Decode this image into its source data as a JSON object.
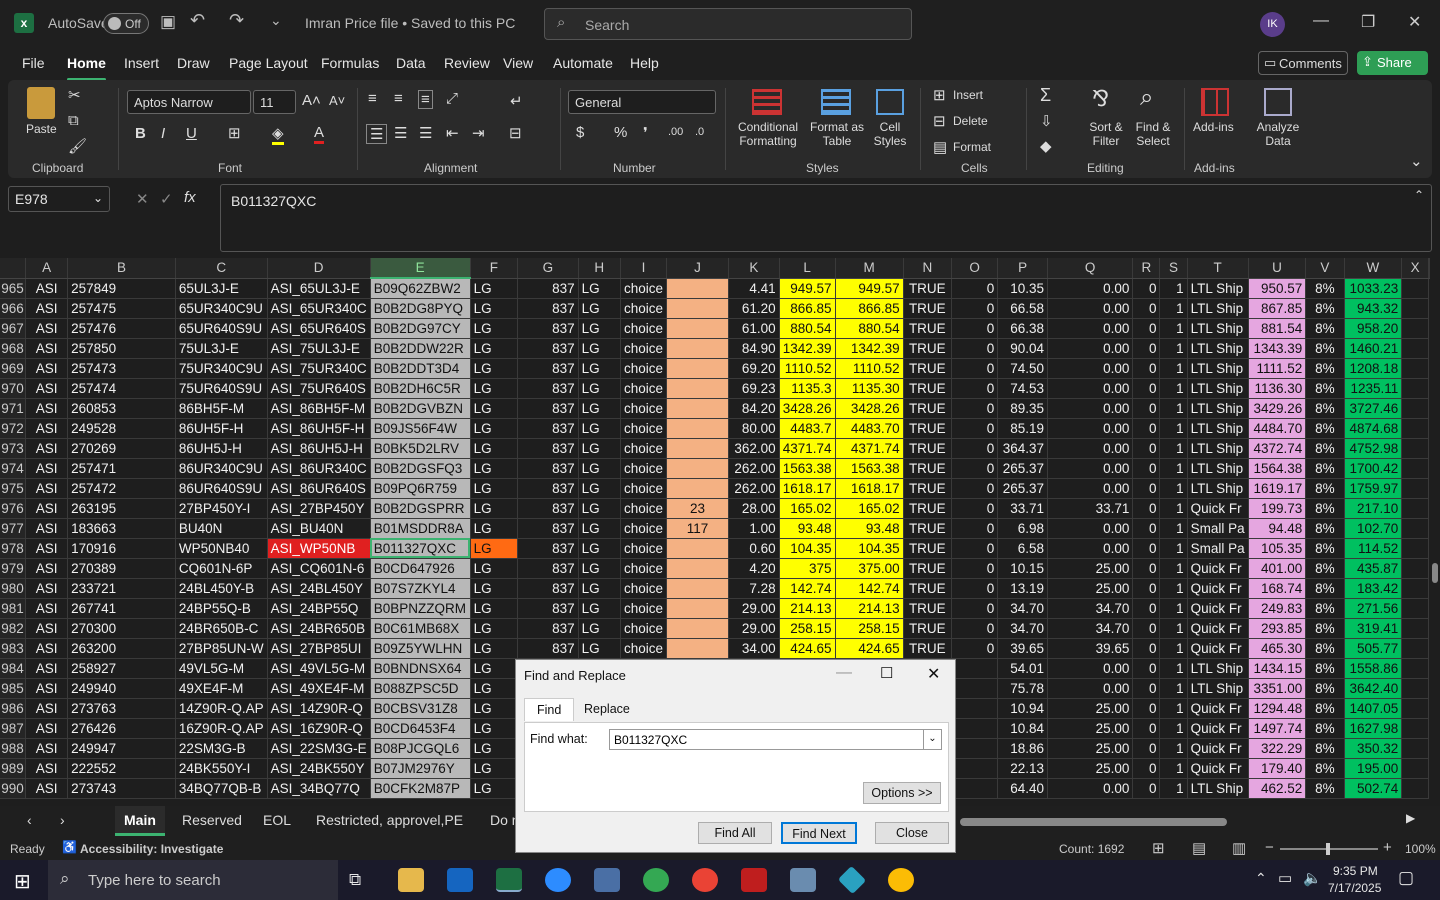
{
  "titlebar": {
    "autosave_label": "AutoSave",
    "autosave_state": "Off",
    "file_title": "Imran Price file • Saved to this PC",
    "search_placeholder": "Search",
    "avatar": "IK"
  },
  "menu": [
    "File",
    "Home",
    "Insert",
    "Draw",
    "Page Layout",
    "Formulas",
    "Data",
    "Review",
    "View",
    "Automate",
    "Help"
  ],
  "active_menu": "Home",
  "actions": {
    "comments": "Comments",
    "share": "Share"
  },
  "ribbon": {
    "clipboard": {
      "label": "Clipboard",
      "paste": "Paste"
    },
    "font": {
      "label": "Font",
      "name": "Aptos Narrow",
      "size": "11"
    },
    "alignment": {
      "label": "Alignment"
    },
    "number": {
      "label": "Number",
      "format": "General"
    },
    "styles": {
      "label": "Styles",
      "conditional": "Conditional Formatting",
      "format_table": "Format as Table",
      "cell_styles": "Cell Styles"
    },
    "cells": {
      "label": "Cells",
      "insert": "Insert",
      "delete": "Delete",
      "format": "Format"
    },
    "editing": {
      "label": "Editing",
      "sort": "Sort & Filter",
      "find": "Find & Select"
    },
    "addins": {
      "label": "Add-ins",
      "addins": "Add-ins",
      "analyze": "Analyze Data"
    }
  },
  "formula": {
    "name_box": "E978",
    "fx": "fx",
    "value": "B011327QXC"
  },
  "grid": {
    "columns": [
      "A",
      "B",
      "C",
      "D",
      "E",
      "F",
      "G",
      "H",
      "I",
      "J",
      "K",
      "L",
      "M",
      "N",
      "O",
      "P",
      "Q",
      "R",
      "S",
      "T",
      "U",
      "V",
      "W",
      "X"
    ],
    "rows": [
      [
        "965",
        "ASI",
        "257849",
        "65UL3J-E",
        "ASI_65UL3J-E",
        "B09Q62ZBW2",
        "LG",
        "837",
        "LG",
        "choice",
        "",
        "4.41",
        "949.57",
        "949.57",
        "TRUE",
        "0",
        "10.35",
        "0.00",
        "0",
        "1",
        "LTL Ship",
        "950.57",
        "8%",
        "1033.23"
      ],
      [
        "966",
        "ASI",
        "257475",
        "65UR340C9U",
        "ASI_65UR340C",
        "B0B2DG8PYQ",
        "LG",
        "837",
        "LG",
        "choice",
        "",
        "61.20",
        "866.85",
        "866.85",
        "TRUE",
        "0",
        "66.58",
        "0.00",
        "0",
        "1",
        "LTL Ship",
        "867.85",
        "8%",
        "943.32"
      ],
      [
        "967",
        "ASI",
        "257476",
        "65UR640S9U",
        "ASI_65UR640S",
        "B0B2DG97CY",
        "LG",
        "837",
        "LG",
        "choice",
        "",
        "61.00",
        "880.54",
        "880.54",
        "TRUE",
        "0",
        "66.38",
        "0.00",
        "0",
        "1",
        "LTL Ship",
        "881.54",
        "8%",
        "958.20"
      ],
      [
        "968",
        "ASI",
        "257850",
        "75UL3J-E",
        "ASI_75UL3J-E",
        "B0B2DDW22R",
        "LG",
        "837",
        "LG",
        "choice",
        "",
        "84.90",
        "1342.39",
        "1342.39",
        "TRUE",
        "0",
        "90.04",
        "0.00",
        "0",
        "1",
        "LTL Ship",
        "1343.39",
        "8%",
        "1460.21"
      ],
      [
        "969",
        "ASI",
        "257473",
        "75UR340C9U",
        "ASI_75UR340C",
        "B0B2DDT3D4",
        "LG",
        "837",
        "LG",
        "choice",
        "",
        "69.20",
        "1110.52",
        "1110.52",
        "TRUE",
        "0",
        "74.50",
        "0.00",
        "0",
        "1",
        "LTL Ship",
        "1111.52",
        "8%",
        "1208.18"
      ],
      [
        "970",
        "ASI",
        "257474",
        "75UR640S9U",
        "ASI_75UR640S",
        "B0B2DH6C5R",
        "LG",
        "837",
        "LG",
        "choice",
        "",
        "69.23",
        "1135.3",
        "1135.30",
        "TRUE",
        "0",
        "74.53",
        "0.00",
        "0",
        "1",
        "LTL Ship",
        "1136.30",
        "8%",
        "1235.11"
      ],
      [
        "971",
        "ASI",
        "260853",
        "86BH5F-M",
        "ASI_86BH5F-M",
        "B0B2DGVBZN",
        "LG",
        "837",
        "LG",
        "choice",
        "",
        "84.20",
        "3428.26",
        "3428.26",
        "TRUE",
        "0",
        "89.35",
        "0.00",
        "0",
        "1",
        "LTL Ship",
        "3429.26",
        "8%",
        "3727.46"
      ],
      [
        "972",
        "ASI",
        "249528",
        "86UH5F-H",
        "ASI_86UH5F-H",
        "B09JS56F4W",
        "LG",
        "837",
        "LG",
        "choice",
        "",
        "80.00",
        "4483.7",
        "4483.70",
        "TRUE",
        "0",
        "85.19",
        "0.00",
        "0",
        "1",
        "LTL Ship",
        "4484.70",
        "8%",
        "4874.68"
      ],
      [
        "973",
        "ASI",
        "270269",
        "86UH5J-H",
        "ASI_86UH5J-H",
        "B0BK5D2LRV",
        "LG",
        "837",
        "LG",
        "choice",
        "",
        "362.00",
        "4371.74",
        "4371.74",
        "TRUE",
        "0",
        "364.37",
        "0.00",
        "0",
        "1",
        "LTL Ship",
        "4372.74",
        "8%",
        "4752.98"
      ],
      [
        "974",
        "ASI",
        "257471",
        "86UR340C9U",
        "ASI_86UR340C",
        "B0B2DGSFQ3",
        "LG",
        "837",
        "LG",
        "choice",
        "",
        "262.00",
        "1563.38",
        "1563.38",
        "TRUE",
        "0",
        "265.37",
        "0.00",
        "0",
        "1",
        "LTL Ship",
        "1564.38",
        "8%",
        "1700.42"
      ],
      [
        "975",
        "ASI",
        "257472",
        "86UR640S9U",
        "ASI_86UR640S",
        "B09PQ6R759",
        "LG",
        "837",
        "LG",
        "choice",
        "",
        "262.00",
        "1618.17",
        "1618.17",
        "TRUE",
        "0",
        "265.37",
        "0.00",
        "0",
        "1",
        "LTL Ship",
        "1619.17",
        "8%",
        "1759.97"
      ],
      [
        "976",
        "ASI",
        "263195",
        "27BP450Y-I",
        "ASI_27BP450Y",
        "B0B2DGSPRR",
        "LG",
        "837",
        "LG",
        "choice",
        "23",
        "28.00",
        "165.02",
        "165.02",
        "TRUE",
        "0",
        "33.71",
        "33.71",
        "0",
        "1",
        "Quick Fr",
        "199.73",
        "8%",
        "217.10"
      ],
      [
        "977",
        "ASI",
        "183663",
        "BU40N",
        "ASI_BU40N",
        "B01MSDDR8A",
        "LG",
        "837",
        "LG",
        "choice",
        "117",
        "1.00",
        "93.48",
        "93.48",
        "TRUE",
        "0",
        "6.98",
        "0.00",
        "0",
        "1",
        "Small Pa",
        "94.48",
        "8%",
        "102.70"
      ],
      [
        "978",
        "ASI",
        "170916",
        "WP50NB40",
        "ASI_WP50NB",
        "B011327QXC",
        "LG",
        "837",
        "LG",
        "choice",
        "",
        "0.60",
        "104.35",
        "104.35",
        "TRUE",
        "0",
        "6.58",
        "0.00",
        "0",
        "1",
        "Small Pa",
        "105.35",
        "8%",
        "114.52"
      ],
      [
        "979",
        "ASI",
        "270389",
        "CQ601N-6P",
        "ASI_CQ601N-6",
        "B0CD647926",
        "LG",
        "837",
        "LG",
        "choice",
        "",
        "4.20",
        "375",
        "375.00",
        "TRUE",
        "0",
        "10.15",
        "25.00",
        "0",
        "1",
        "Quick Fr",
        "401.00",
        "8%",
        "435.87"
      ],
      [
        "980",
        "ASI",
        "233721",
        "24BL450Y-B",
        "ASI_24BL450Y",
        "B07S7ZKYL4",
        "LG",
        "837",
        "LG",
        "choice",
        "",
        "7.28",
        "142.74",
        "142.74",
        "TRUE",
        "0",
        "13.19",
        "25.00",
        "0",
        "1",
        "Quick Fr",
        "168.74",
        "8%",
        "183.42"
      ],
      [
        "981",
        "ASI",
        "267741",
        "24BP55Q-B",
        "ASI_24BP55Q",
        "B0BPNZZQRM",
        "LG",
        "837",
        "LG",
        "choice",
        "",
        "29.00",
        "214.13",
        "214.13",
        "TRUE",
        "0",
        "34.70",
        "34.70",
        "0",
        "1",
        "Quick Fr",
        "249.83",
        "8%",
        "271.56"
      ],
      [
        "982",
        "ASI",
        "270300",
        "24BR650B-C",
        "ASI_24BR650B",
        "B0C61MB68X",
        "LG",
        "837",
        "LG",
        "choice",
        "",
        "29.00",
        "258.15",
        "258.15",
        "TRUE",
        "0",
        "34.70",
        "34.70",
        "0",
        "1",
        "Quick Fr",
        "293.85",
        "8%",
        "319.41"
      ],
      [
        "983",
        "ASI",
        "263200",
        "27BP85UN-W",
        "ASI_27BP85UI",
        "B09Z5YWLHN",
        "LG",
        "837",
        "LG",
        "choice",
        "",
        "34.00",
        "424.65",
        "424.65",
        "TRUE",
        "0",
        "39.65",
        "39.65",
        "0",
        "1",
        "Quick Fr",
        "465.30",
        "8%",
        "505.77"
      ],
      [
        "984",
        "ASI",
        "258927",
        "49VL5G-M",
        "ASI_49VL5G-M",
        "B0BNDNSX64",
        "LG",
        "",
        "",
        "",
        "",
        "",
        "",
        "",
        "",
        "",
        "54.01",
        "0.00",
        "0",
        "1",
        "LTL Ship",
        "1434.15",
        "8%",
        "1558.86"
      ],
      [
        "985",
        "ASI",
        "249940",
        "49XE4F-M",
        "ASI_49XE4F-M",
        "B088ZPSC5D",
        "LG",
        "",
        "",
        "",
        "",
        "",
        "",
        "",
        "",
        "",
        "75.78",
        "0.00",
        "0",
        "1",
        "LTL Ship",
        "3351.00",
        "8%",
        "3642.40"
      ],
      [
        "986",
        "ASI",
        "273763",
        "14Z90R-Q.AP",
        "ASI_14Z90R-Q",
        "B0CBSV31Z8",
        "LG",
        "",
        "",
        "",
        "",
        "",
        "",
        "",
        "",
        "",
        "10.94",
        "25.00",
        "0",
        "1",
        "Quick Fr",
        "1294.48",
        "8%",
        "1407.05"
      ],
      [
        "987",
        "ASI",
        "276426",
        "16Z90R-Q.AP",
        "ASI_16Z90R-Q",
        "B0CD6453F4",
        "LG",
        "",
        "",
        "",
        "",
        "",
        "",
        "",
        "",
        "",
        "10.84",
        "25.00",
        "0",
        "1",
        "Quick Fr",
        "1497.74",
        "8%",
        "1627.98"
      ],
      [
        "988",
        "ASI",
        "249947",
        "22SM3G-B",
        "ASI_22SM3G-E",
        "B08PJCGQL6",
        "LG",
        "",
        "",
        "",
        "",
        "",
        "",
        "",
        "",
        "",
        "18.86",
        "25.00",
        "0",
        "1",
        "Quick Fr",
        "322.29",
        "8%",
        "350.32"
      ],
      [
        "989",
        "ASI",
        "222552",
        "24BK550Y-I",
        "ASI_24BK550Y",
        "B07JM2976Y",
        "LG",
        "",
        "",
        "",
        "",
        "",
        "",
        "",
        "",
        "",
        "22.13",
        "25.00",
        "0",
        "1",
        "Quick Fr",
        "179.40",
        "8%",
        "195.00"
      ],
      [
        "990",
        "ASI",
        "273743",
        "34BQ77QB-B",
        "ASI_34BQ77Q",
        "B0CFK2M87P",
        "LG",
        "",
        "",
        "",
        "",
        "",
        "",
        "",
        "",
        "",
        "64.40",
        "0.00",
        "0",
        "1",
        "LTL Ship",
        "462.52",
        "8%",
        "502.74"
      ]
    ]
  },
  "sheets": [
    "Main",
    "Reserved",
    "EOL",
    "Restricted, approvel,PE",
    "Do n"
  ],
  "active_sheet": "Main",
  "status": {
    "ready": "Ready",
    "accessibility": "Accessibility: Investigate",
    "count": "Count: 1692",
    "zoom": "100%"
  },
  "taskbar": {
    "search_placeholder": "Type here to search",
    "time": "9:35 PM",
    "date": "7/17/2025"
  },
  "dialog": {
    "title": "Find and Replace",
    "tab_find": "Find",
    "tab_replace": "Replace",
    "find_label": "Find what:",
    "find_value": "B011327QXC",
    "options": "Options >>",
    "find_all": "Find All",
    "find_next": "Find Next",
    "close": "Close"
  },
  "colors": {
    "accent_green": "#3cb371",
    "highlight_yellow": "#ffff00",
    "peach": "#f4b183",
    "pink": "#e5a6e0",
    "green_col": "#00c060",
    "gray_col": "#b8b8b8",
    "red_cell": "#e02020",
    "orange_cell": "#ff6a13"
  }
}
